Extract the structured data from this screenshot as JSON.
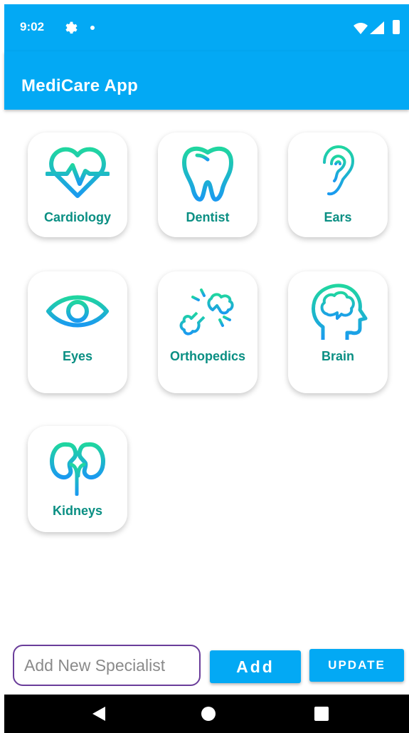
{
  "status_bar": {
    "time": "9:02",
    "icons": [
      "gear-icon",
      "notification-dot-icon",
      "wifi-icon",
      "signal-icon",
      "battery-icon"
    ]
  },
  "app_bar": {
    "title": "MediCare App"
  },
  "colors": {
    "primary": "#03a9f4",
    "label": "#0a8f83",
    "icon_gradient_start": "#20d6a0",
    "icon_gradient_end": "#1a9af0",
    "input_border": "#6a3d9a"
  },
  "specialties": [
    {
      "label": "Cardiology",
      "icon": "heart-pulse-icon"
    },
    {
      "label": "Dentist",
      "icon": "tooth-icon"
    },
    {
      "label": "Ears",
      "icon": "ear-icon"
    },
    {
      "label": "Eyes",
      "icon": "eye-icon"
    },
    {
      "label": "Orthopedics",
      "icon": "broken-bone-icon"
    },
    {
      "label": "Brain",
      "icon": "brain-head-icon"
    },
    {
      "label": "Kidneys",
      "icon": "kidneys-icon"
    }
  ],
  "form": {
    "input_placeholder": "Add New Specialist",
    "add_label": "Add",
    "update_label": "UPDATE"
  },
  "nav_bar": {
    "icons": [
      "back-icon",
      "home-icon",
      "recents-icon"
    ]
  }
}
